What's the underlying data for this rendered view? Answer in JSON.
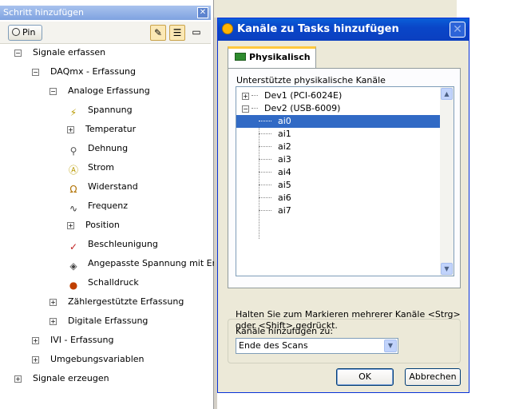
{
  "left_panel": {
    "title": "Schritt hinzufügen",
    "close": "✕",
    "pin_label": "Pin",
    "tree": [
      {
        "label": "Signale erfassen",
        "exp": "−",
        "icon": ""
      },
      {
        "label": "DAQmx - Erfassung",
        "exp": "−",
        "icon": ""
      },
      {
        "label": "Analoge Erfassung",
        "exp": "−",
        "icon": ""
      },
      {
        "label": "Spannung",
        "exp": "",
        "icon": "voltage-icon"
      },
      {
        "label": "Temperatur",
        "exp": "+",
        "icon": ""
      },
      {
        "label": "Dehnung",
        "exp": "",
        "icon": "strain-icon"
      },
      {
        "label": "Strom",
        "exp": "",
        "icon": "current-icon"
      },
      {
        "label": "Widerstand",
        "exp": "",
        "icon": "resistance-icon"
      },
      {
        "label": "Frequenz",
        "exp": "",
        "icon": "frequency-icon"
      },
      {
        "label": "Position",
        "exp": "+",
        "icon": ""
      },
      {
        "label": "Beschleunigung",
        "exp": "",
        "icon": "acceleration-icon"
      },
      {
        "label": "Angepasste Spannung mit Er...",
        "exp": "",
        "icon": "custom-voltage-icon"
      },
      {
        "label": "Schalldruck",
        "exp": "",
        "icon": "microphone-icon"
      },
      {
        "label": "Zählergestützte Erfassung",
        "exp": "+",
        "icon": ""
      },
      {
        "label": "Digitale Erfassung",
        "exp": "+",
        "icon": ""
      },
      {
        "label": "IVI - Erfassung",
        "exp": "+",
        "icon": ""
      },
      {
        "label": "Umgebungsvariablen",
        "exp": "+",
        "icon": ""
      },
      {
        "label": "Signale erzeugen",
        "exp": "+",
        "icon": ""
      }
    ]
  },
  "dialog": {
    "title": "Kanäle zu Tasks hinzufügen",
    "tab_label": "Physikalisch",
    "channels_label": "Unterstützte physikalische Kanäle",
    "devices": [
      {
        "label": "Dev1  (PCI-6024E)",
        "exp": "+"
      },
      {
        "label": "Dev2  (USB-6009)",
        "exp": "−"
      }
    ],
    "channels": [
      "ai0",
      "ai1",
      "ai2",
      "ai3",
      "ai4",
      "ai5",
      "ai6",
      "ai7"
    ],
    "selected_channel": "ai0",
    "hint": "Halten Sie zum Markieren mehrerer Kanäle <Strg> oder <Shift> gedrückt.",
    "add_to_label": "Kanäle hinzufügen zu:",
    "add_to_value": "Ende des Scans",
    "ok_label": "OK",
    "cancel_label": "Abbrechen"
  },
  "colors": {
    "selection": "#316ac5",
    "title_bar": "#0a46c8",
    "dialog_bg": "#ece9d8"
  }
}
